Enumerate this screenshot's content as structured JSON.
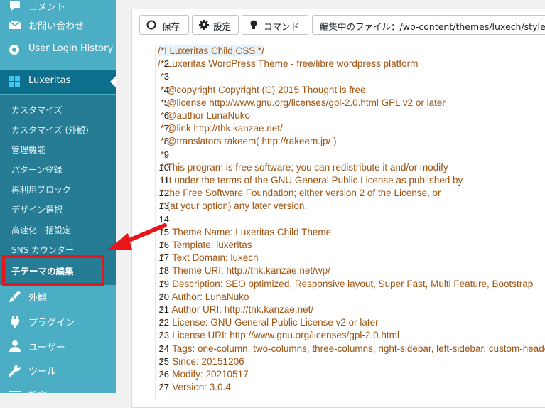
{
  "sidebar": {
    "top_items": [
      {
        "label": "コメント",
        "icon": "comment-icon"
      },
      {
        "label": "お問い合わせ",
        "icon": "mail-icon"
      },
      {
        "label": "User Login History",
        "icon": "history-icon"
      }
    ],
    "active_menu": {
      "label": "Luxeritas",
      "icon": "grid-icon"
    },
    "submenu": [
      "カスタマイズ",
      "カスタマイズ (外観)",
      "管理機能",
      "パターン登録",
      "再利用ブロック",
      "デザイン選択",
      "高速化一括設定",
      "SNS カウンター",
      "子テーマの編集"
    ],
    "current_submenu": "子テーマの編集",
    "bottom_items": [
      {
        "label": "外観",
        "icon": "brush-icon"
      },
      {
        "label": "プラグイン",
        "icon": "plugin-icon"
      },
      {
        "label": "ユーザー",
        "icon": "user-icon"
      },
      {
        "label": "ツール",
        "icon": "wrench-icon"
      },
      {
        "label": "設定",
        "icon": "settings-icon"
      }
    ]
  },
  "toolbar": {
    "save_label": "保存",
    "settings_label": "設定",
    "command_label": "コマンド",
    "file_label": "編集中のファイル：/wp-content/themes/luxech/style.css"
  },
  "code_lines": [
    "/*! Luxeritas Child CSS */",
    "/* Luxeritas WordPress Theme - free/libre wordpress platform",
    " *",
    " * @copyright Copyright (C) 2015 Thought is free.",
    " * @license http://www.gnu.org/licenses/gpl-2.0.html GPL v2 or later",
    " * @author LunaNuko",
    " * @link http://thk.kanzae.net/",
    " * @translators rakeem( http://rakeem.jp/ )",
    " *",
    " * This program is free software; you can redistribute it and/or modify",
    " * it under the terms of the GNU General Public License as published by",
    " * the Free Software Foundation; either version 2 of the License, or",
    " * (at your option) any later version.",
    "",
    " *   Theme Name: Luxeritas Child Theme",
    " *   Template: luxeritas",
    " *   Text Domain: luxech",
    " *   Theme URI: http://thk.kanzae.net/wp/",
    " *   Description: SEO optimized, Responsive layout, Super Fast, Multi Feature, Bootstrap",
    " *   Author: LunaNuko",
    " *   Author URI: http://thk.kanzae.net/",
    " *   License: GNU General Public License v2 or later",
    " *   License URI: http://www.gnu.org/licenses/gpl-2.0.html",
    " *   Tags: one-column, two-columns, three-columns, right-sidebar, left-sidebar, custom-header",
    " *   Since: 20151206",
    " *   Modify: 20210517",
    " *   Version: 3.0.4"
  ],
  "colors": {
    "sidebar": "#4caec5",
    "submenu": "#267c94",
    "active": "#0e6f8c",
    "annotation": "#e8151b",
    "code": "#a0520f"
  }
}
